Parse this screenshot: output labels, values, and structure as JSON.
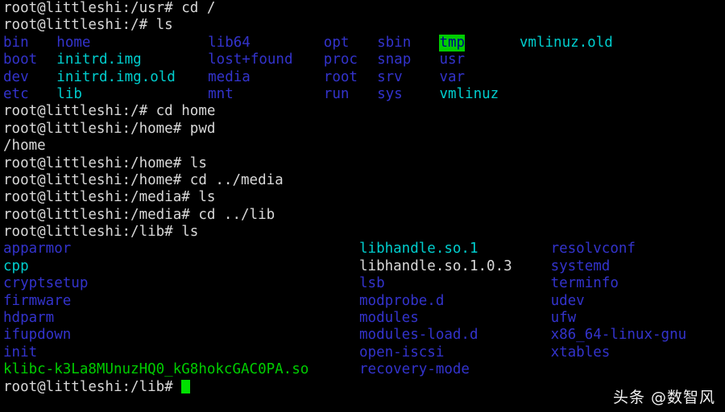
{
  "terminal": {
    "colors": {
      "background": "#000000",
      "foreground": "#d8d8d8",
      "directory": "#3333cc",
      "symlink": "#00cdcd",
      "executable": "#00cd00",
      "sticky_bg": "#00cc00",
      "sticky_fg": "#00008b",
      "cursor": "#00e000"
    },
    "char_width": 11.05,
    "line_height": 21.4,
    "lines": [
      {
        "id": "line-1-prompt-cd-root",
        "cells": [
          {
            "col": 0,
            "text": "root@littleshi:/usr# cd /",
            "style": "c-prompt"
          }
        ]
      },
      {
        "id": "line-2-prompt-ls-root",
        "cells": [
          {
            "col": 0,
            "text": "root@littleshi:/# ls",
            "style": "c-prompt"
          }
        ]
      },
      {
        "id": "line-3-ls-row-1",
        "cells": [
          {
            "col": 0,
            "text": "bin",
            "style": "c-dir"
          },
          {
            "col": 6,
            "text": "home",
            "style": "c-dir"
          },
          {
            "col": 23,
            "text": "lib64",
            "style": "c-dir"
          },
          {
            "col": 36,
            "text": "opt",
            "style": "c-dir"
          },
          {
            "col": 42,
            "text": "sbin",
            "style": "c-dir"
          },
          {
            "col": 49,
            "text": "tmp",
            "style": "c-sticky"
          },
          {
            "col": 58,
            "text": "vmlinuz.old",
            "style": "c-link"
          }
        ]
      },
      {
        "id": "line-4-ls-row-2",
        "cells": [
          {
            "col": 0,
            "text": "boot",
            "style": "c-dir"
          },
          {
            "col": 6,
            "text": "initrd.img",
            "style": "c-link"
          },
          {
            "col": 23,
            "text": "lost+found",
            "style": "c-dir"
          },
          {
            "col": 36,
            "text": "proc",
            "style": "c-dir"
          },
          {
            "col": 42,
            "text": "snap",
            "style": "c-dir"
          },
          {
            "col": 49,
            "text": "usr",
            "style": "c-dir"
          }
        ]
      },
      {
        "id": "line-5-ls-row-3",
        "cells": [
          {
            "col": 0,
            "text": "dev",
            "style": "c-dir"
          },
          {
            "col": 6,
            "text": "initrd.img.old",
            "style": "c-link"
          },
          {
            "col": 23,
            "text": "media",
            "style": "c-dir"
          },
          {
            "col": 36,
            "text": "root",
            "style": "c-dir"
          },
          {
            "col": 42,
            "text": "srv",
            "style": "c-dir"
          },
          {
            "col": 49,
            "text": "var",
            "style": "c-dir"
          }
        ]
      },
      {
        "id": "line-6-ls-row-4",
        "cells": [
          {
            "col": 0,
            "text": "etc",
            "style": "c-dir"
          },
          {
            "col": 6,
            "text": "lib",
            "style": "c-link"
          },
          {
            "col": 23,
            "text": "mnt",
            "style": "c-dir"
          },
          {
            "col": 36,
            "text": "run",
            "style": "c-dir"
          },
          {
            "col": 42,
            "text": "sys",
            "style": "c-dir"
          },
          {
            "col": 49,
            "text": "vmlinuz",
            "style": "c-link"
          }
        ]
      },
      {
        "id": "line-7-prompt-cd-home",
        "cells": [
          {
            "col": 0,
            "text": "root@littleshi:/# cd home",
            "style": "c-prompt"
          }
        ]
      },
      {
        "id": "line-8-prompt-pwd",
        "cells": [
          {
            "col": 0,
            "text": "root@littleshi:/home# pwd",
            "style": "c-prompt"
          }
        ]
      },
      {
        "id": "line-9-pwd-output",
        "cells": [
          {
            "col": 0,
            "text": "/home",
            "style": "c-default"
          }
        ]
      },
      {
        "id": "line-10-prompt-ls-home",
        "cells": [
          {
            "col": 0,
            "text": "root@littleshi:/home# ls",
            "style": "c-prompt"
          }
        ]
      },
      {
        "id": "line-11-prompt-cd-media",
        "cells": [
          {
            "col": 0,
            "text": "root@littleshi:/home# cd ../media",
            "style": "c-prompt"
          }
        ]
      },
      {
        "id": "line-12-prompt-ls-media",
        "cells": [
          {
            "col": 0,
            "text": "root@littleshi:/media# ls",
            "style": "c-prompt"
          }
        ]
      },
      {
        "id": "line-13-prompt-cd-lib",
        "cells": [
          {
            "col": 0,
            "text": "root@littleshi:/media# cd ../lib",
            "style": "c-prompt"
          }
        ]
      },
      {
        "id": "line-14-prompt-ls-lib",
        "cells": [
          {
            "col": 0,
            "text": "root@littleshi:/lib# ls",
            "style": "c-prompt"
          }
        ]
      },
      {
        "id": "line-15-lib-row-1",
        "cells": [
          {
            "col": 0,
            "text": "apparmor",
            "style": "c-dir"
          },
          {
            "col": 40,
            "text": "libhandle.so.1",
            "style": "c-link"
          },
          {
            "col": 61.5,
            "text": "resolvconf",
            "style": "c-dir"
          }
        ]
      },
      {
        "id": "line-16-lib-row-2",
        "cells": [
          {
            "col": 0,
            "text": "cpp",
            "style": "c-link"
          },
          {
            "col": 40,
            "text": "libhandle.so.1.0.3",
            "style": "c-file"
          },
          {
            "col": 61.5,
            "text": "systemd",
            "style": "c-dir"
          }
        ]
      },
      {
        "id": "line-17-lib-row-3",
        "cells": [
          {
            "col": 0,
            "text": "cryptsetup",
            "style": "c-dir"
          },
          {
            "col": 40,
            "text": "lsb",
            "style": "c-dir"
          },
          {
            "col": 61.5,
            "text": "terminfo",
            "style": "c-dir"
          }
        ]
      },
      {
        "id": "line-18-lib-row-4",
        "cells": [
          {
            "col": 0,
            "text": "firmware",
            "style": "c-dir"
          },
          {
            "col": 40,
            "text": "modprobe.d",
            "style": "c-dir"
          },
          {
            "col": 61.5,
            "text": "udev",
            "style": "c-dir"
          }
        ]
      },
      {
        "id": "line-19-lib-row-5",
        "cells": [
          {
            "col": 0,
            "text": "hdparm",
            "style": "c-dir"
          },
          {
            "col": 40,
            "text": "modules",
            "style": "c-dir"
          },
          {
            "col": 61.5,
            "text": "ufw",
            "style": "c-dir"
          }
        ]
      },
      {
        "id": "line-20-lib-row-6",
        "cells": [
          {
            "col": 0,
            "text": "ifupdown",
            "style": "c-dir"
          },
          {
            "col": 40,
            "text": "modules-load.d",
            "style": "c-dir"
          },
          {
            "col": 61.5,
            "text": "x86_64-linux-gnu",
            "style": "c-dir"
          }
        ]
      },
      {
        "id": "line-21-lib-row-7",
        "cells": [
          {
            "col": 0,
            "text": "init",
            "style": "c-dir"
          },
          {
            "col": 40,
            "text": "open-iscsi",
            "style": "c-dir"
          },
          {
            "col": 61.5,
            "text": "xtables",
            "style": "c-dir"
          }
        ]
      },
      {
        "id": "line-22-lib-row-8",
        "cells": [
          {
            "col": 0,
            "text": "klibc-k3La8MUnuzHQ0_kG8hokcGAC0PA.so",
            "style": "c-exec"
          },
          {
            "col": 40,
            "text": "recovery-mode",
            "style": "c-dir"
          }
        ]
      },
      {
        "id": "line-23-prompt-final",
        "cells": [
          {
            "col": 0,
            "text": "root@littleshi:/lib# ",
            "style": "c-prompt",
            "cursor": true
          }
        ]
      }
    ]
  },
  "watermark": {
    "text": "头条 @数智风"
  }
}
